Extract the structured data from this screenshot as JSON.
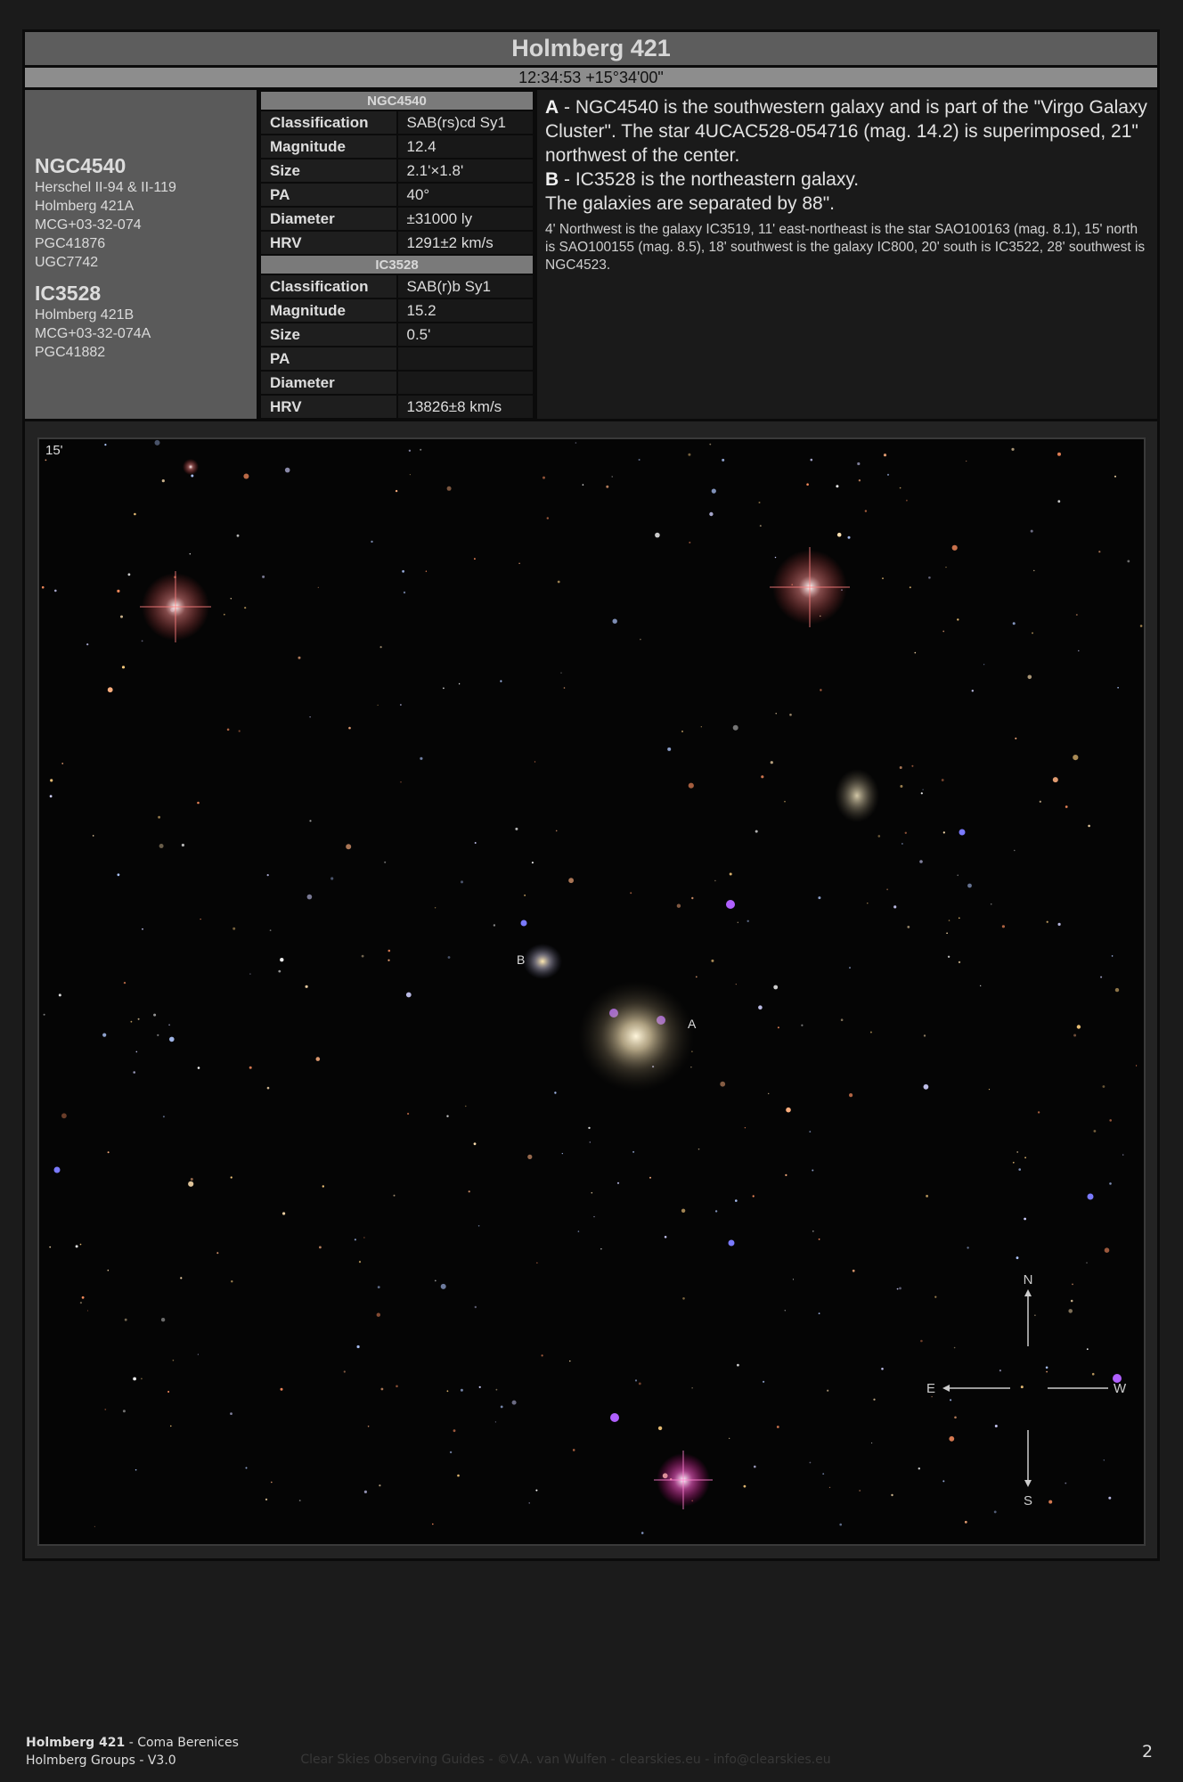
{
  "header": {
    "title": "Holmberg 421",
    "coordinates": "12:34:53 +15°34'00\""
  },
  "objects": [
    {
      "name": "NGC4540",
      "aliases": [
        "Herschel II-94 & II-119",
        "Holmberg 421A",
        "MCG+03-32-074",
        "PGC41876",
        "UGC7742"
      ],
      "properties": {
        "Classification": "SAB(rs)cd Sy1",
        "Magnitude": "12.4",
        "Size": "2.1'×1.8'",
        "PA": "40°",
        "Diameter": "±31000 ly",
        "HRV": "1291±2 km/s"
      }
    },
    {
      "name": "IC3528",
      "aliases": [
        "Holmberg 421B",
        "MCG+03-32-074A",
        "PGC41882"
      ],
      "properties": {
        "Classification": "SAB(r)b Sy1",
        "Magnitude": "15.2",
        "Size": "0.5'",
        "PA": "",
        "Diameter": "",
        "HRV": "13826±8 km/s"
      }
    }
  ],
  "property_labels": [
    "Classification",
    "Magnitude",
    "Size",
    "PA",
    "Diameter",
    "HRV"
  ],
  "description": {
    "a_letter": "A",
    "a_text": " - NGC4540 is the southwestern galaxy and is part of the \"Virgo Galaxy Cluster\". The star 4UCAC528-054716 (mag. 14.2) is superimposed, 21\" northwest of the center.",
    "b_letter": "B",
    "b_text": " - IC3528 is the northeastern galaxy.",
    "separation": "The galaxies are separated by 88\".",
    "surroundings": "4' Northwest is the galaxy IC3519, 11' east-northeast is the star SAO100163 (mag. 8.1), 15' north is SAO100155 (mag. 8.5), 18' southwest is the galaxy IC800, 20' south is IC3522, 28' southwest is NGC4523."
  },
  "image": {
    "fov": "15'",
    "label_a": "A",
    "label_b": "B",
    "compass": {
      "n": "N",
      "e": "E",
      "s": "S",
      "w": "W"
    }
  },
  "footer": {
    "title_bold": "Holmberg 421",
    "constellation": " - Coma Berenices",
    "series": "Holmberg Groups - V3.0",
    "credit": "Clear Skies Observing Guides - ©V.A. van Wulfen - clearskies.eu - info@clearskies.eu",
    "page": "2"
  }
}
